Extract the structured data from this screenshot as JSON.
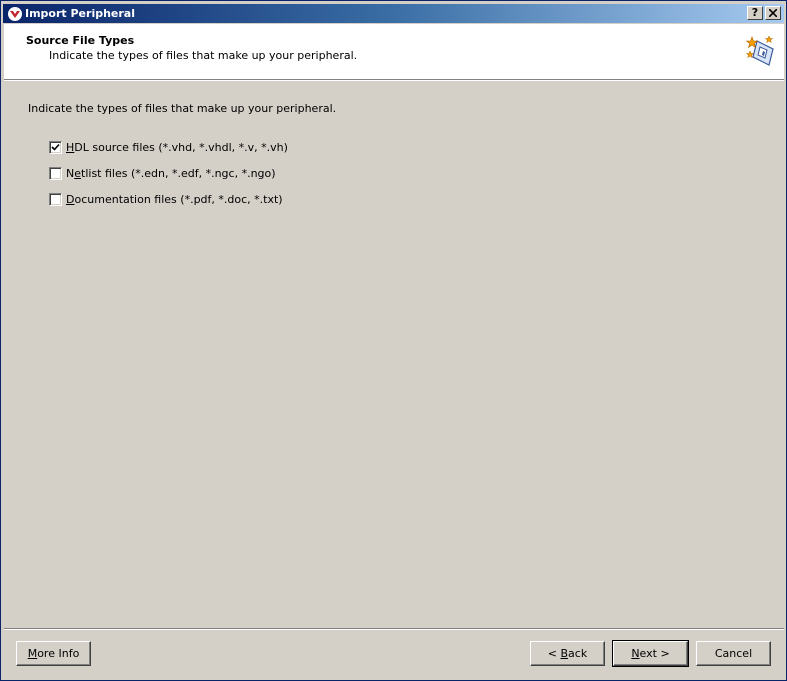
{
  "window": {
    "title": "Import Peripheral",
    "help_btn": "?",
    "close_btn": "✕"
  },
  "header": {
    "title": "Source File Types",
    "subtitle": "Indicate the types of files that make up your peripheral."
  },
  "body": {
    "description": "Indicate the types of files that make up your peripheral.",
    "options": [
      {
        "mnemonic": "H",
        "rest": "DL source files (*.vhd, *.vhdl, *.v, *.vh)",
        "checked": true
      },
      {
        "pre": "N",
        "mnemonic": "e",
        "rest": "tlist files (*.edn, *.edf, *.ngc, *.ngo)",
        "checked": false
      },
      {
        "mnemonic": "D",
        "rest": "ocumentation files (*.pdf, *.doc, *.txt)",
        "checked": false
      }
    ]
  },
  "buttons": {
    "more_info": {
      "mnemonic": "M",
      "rest": "ore Info"
    },
    "back": {
      "pre": "< ",
      "mnemonic": "B",
      "rest": "ack"
    },
    "next": {
      "mnemonic": "N",
      "rest": "ext >"
    },
    "cancel": "Cancel"
  },
  "icons": {
    "app": "xilinx-app-icon",
    "wizard": "wizard-puzzle-icon",
    "check": "checkmark-icon"
  }
}
